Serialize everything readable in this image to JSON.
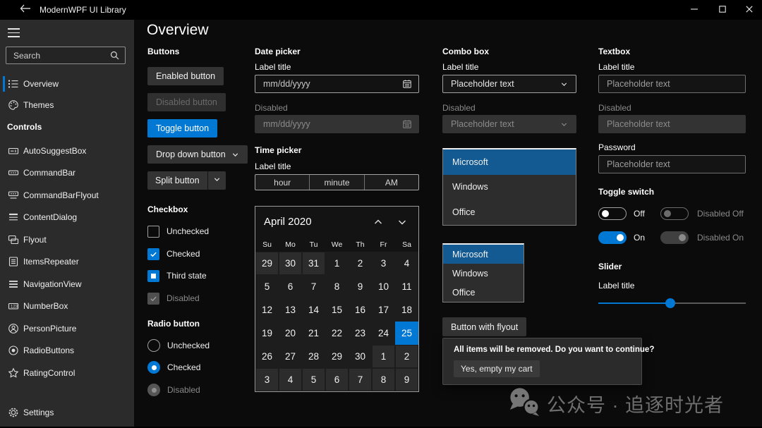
{
  "titlebar": {
    "title": "ModernWPF UI Library"
  },
  "sidebar": {
    "search_placeholder": "Search",
    "top_items": [
      {
        "label": "Overview",
        "icon": "list",
        "selected": true
      },
      {
        "label": "Themes",
        "icon": "palette",
        "selected": false
      }
    ],
    "section_header": "Controls",
    "controls": [
      {
        "label": "AutoSuggestBox",
        "icon": "autosuggest"
      },
      {
        "label": "CommandBar",
        "icon": "commandbar"
      },
      {
        "label": "CommandBarFlyout",
        "icon": "commandbarflyout"
      },
      {
        "label": "ContentDialog",
        "icon": "contentdialog"
      },
      {
        "label": "Flyout",
        "icon": "flyout"
      },
      {
        "label": "ItemsRepeater",
        "icon": "itemsrepeater"
      },
      {
        "label": "NavigationView",
        "icon": "navigationview"
      },
      {
        "label": "NumberBox",
        "icon": "numberbox"
      },
      {
        "label": "PersonPicture",
        "icon": "personpicture"
      },
      {
        "label": "RadioButtons",
        "icon": "radiobuttons"
      },
      {
        "label": "RatingControl",
        "icon": "rating"
      }
    ],
    "settings": {
      "label": "Settings",
      "icon": "settings"
    }
  },
  "page": {
    "title": "Overview"
  },
  "buttons": {
    "header": "Buttons",
    "enabled": "Enabled button",
    "disabled": "Disabled button",
    "toggle": "Toggle button",
    "dropdown": "Drop down button",
    "split": "Split button"
  },
  "checkbox": {
    "header": "Checkbox",
    "rows": [
      {
        "label": "Unchecked",
        "state": "unchecked"
      },
      {
        "label": "Checked",
        "state": "checked"
      },
      {
        "label": "Third state",
        "state": "third"
      },
      {
        "label": "Disabled",
        "state": "disabled"
      }
    ]
  },
  "radio": {
    "header": "Radio button",
    "rows": [
      {
        "label": "Unchecked",
        "state": "unchecked"
      },
      {
        "label": "Checked",
        "state": "checked"
      },
      {
        "label": "Disabled",
        "state": "disabled"
      }
    ]
  },
  "datepicker": {
    "header": "Date picker",
    "label": "Label title",
    "placeholder": "mm/dd/yyyy",
    "disabled_label": "Disabled",
    "disabled_placeholder": "mm/dd/yyyy"
  },
  "timepicker": {
    "header": "Time picker",
    "label": "Label title",
    "segments": [
      "hour",
      "minute",
      "AM"
    ]
  },
  "calendar": {
    "title": "April 2020",
    "weekdays": [
      "Su",
      "Mo",
      "Tu",
      "We",
      "Th",
      "Fr",
      "Sa"
    ],
    "weeks": [
      [
        {
          "d": "29",
          "muted": true
        },
        {
          "d": "30",
          "muted": true
        },
        {
          "d": "31",
          "muted": true
        },
        {
          "d": "1"
        },
        {
          "d": "2"
        },
        {
          "d": "3"
        },
        {
          "d": "4"
        }
      ],
      [
        {
          "d": "5"
        },
        {
          "d": "6"
        },
        {
          "d": "7"
        },
        {
          "d": "8"
        },
        {
          "d": "9"
        },
        {
          "d": "10"
        },
        {
          "d": "11"
        }
      ],
      [
        {
          "d": "12"
        },
        {
          "d": "13"
        },
        {
          "d": "14"
        },
        {
          "d": "15"
        },
        {
          "d": "16"
        },
        {
          "d": "17"
        },
        {
          "d": "18"
        }
      ],
      [
        {
          "d": "19"
        },
        {
          "d": "20"
        },
        {
          "d": "21"
        },
        {
          "d": "22"
        },
        {
          "d": "23"
        },
        {
          "d": "24"
        },
        {
          "d": "25",
          "selected": true
        }
      ],
      [
        {
          "d": "26"
        },
        {
          "d": "27"
        },
        {
          "d": "28"
        },
        {
          "d": "29"
        },
        {
          "d": "30"
        },
        {
          "d": "1",
          "muted": true
        },
        {
          "d": "2",
          "muted": true
        }
      ],
      [
        {
          "d": "3",
          "muted": true
        },
        {
          "d": "4",
          "muted": true
        },
        {
          "d": "5",
          "muted": true
        },
        {
          "d": "6",
          "muted": true
        },
        {
          "d": "7",
          "muted": true
        },
        {
          "d": "8",
          "muted": true
        },
        {
          "d": "9",
          "muted": true
        }
      ]
    ],
    "selected_day": "25"
  },
  "combobox": {
    "header": "Combo box",
    "label": "Label title",
    "placeholder": "Placeholder text",
    "disabled_label": "Disabled",
    "disabled_placeholder": "Placeholder text"
  },
  "listbox": {
    "items": [
      "Microsoft",
      "Windows",
      "Office"
    ],
    "selected_index": 0
  },
  "flyout": {
    "button_label": "Button with flyout",
    "message": "All items will be removed. Do you want to continue?",
    "confirm_label": "Yes, empty my cart"
  },
  "textbox": {
    "header": "Textbox",
    "label": "Label title",
    "placeholder": "Placeholder text",
    "disabled_label": "Disabled",
    "disabled_placeholder": "Placeholder text",
    "password_label": "Password",
    "password_placeholder": "Placeholder text"
  },
  "toggleswitch": {
    "header": "Toggle switch",
    "rows": [
      [
        {
          "label": "Off",
          "state": "off"
        },
        {
          "label": "Disabled Off",
          "state": "disabled-off"
        }
      ],
      [
        {
          "label": "On",
          "state": "on"
        },
        {
          "label": "Disabled On",
          "state": "disabled-on"
        }
      ]
    ]
  },
  "slider": {
    "header": "Slider",
    "label": "Label title",
    "value_pct": 49
  },
  "watermark": {
    "text": "公众号 · 追逐时光者"
  },
  "colors": {
    "accent": "#0078d4",
    "list_selection": "#125a91",
    "sidebar_bg": "#2b2b2b",
    "content_bg": "#0b0b0b",
    "titlebar_bg": "#000000"
  }
}
